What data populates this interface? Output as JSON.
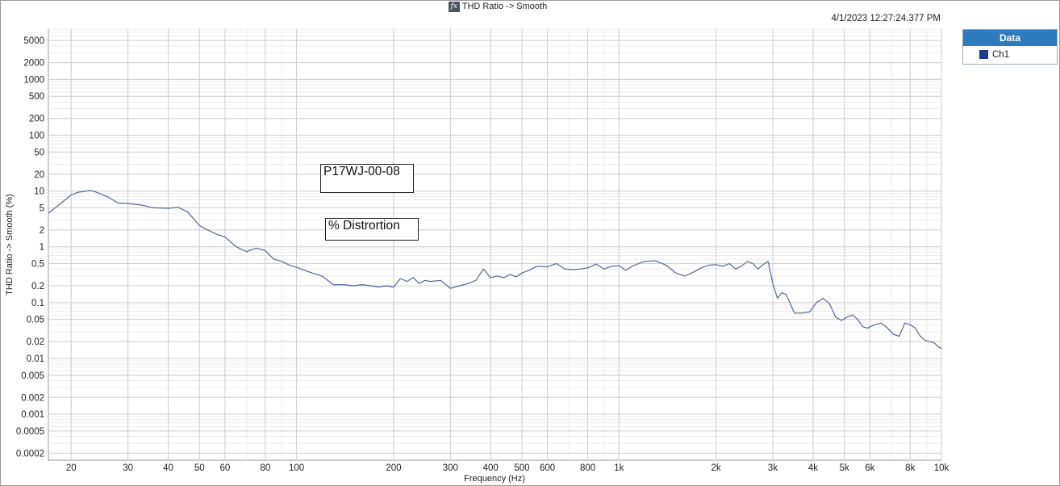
{
  "header": {
    "title": "THD Ratio -> Smooth",
    "fx_icon": "fx-icon",
    "timestamp": "4/1/2023 12:27:24.377 PM",
    "logo": "ap-logo"
  },
  "legend": {
    "header": "Data",
    "items": [
      {
        "label": "Ch1",
        "color": "#1b3a8c"
      }
    ]
  },
  "annotations": [
    "P17WJ-00-08",
    "% Distrortion"
  ],
  "chart_data": {
    "type": "line",
    "title": "THD Ratio -> Smooth",
    "xlabel": "Frequency (Hz)",
    "ylabel": "THD Ratio -> Smooth (%)",
    "xscale": "log",
    "yscale": "log",
    "xlim": [
      17,
      10000
    ],
    "ylim": [
      0.00015,
      8000
    ],
    "grid": true,
    "legend_position": "right",
    "x_ticks": [
      {
        "v": 20,
        "label": "20"
      },
      {
        "v": 30,
        "label": "30"
      },
      {
        "v": 40,
        "label": "40"
      },
      {
        "v": 50,
        "label": "50"
      },
      {
        "v": 60,
        "label": "60"
      },
      {
        "v": 80,
        "label": "80"
      },
      {
        "v": 100,
        "label": "100"
      },
      {
        "v": 200,
        "label": "200"
      },
      {
        "v": 300,
        "label": "300"
      },
      {
        "v": 400,
        "label": "400"
      },
      {
        "v": 500,
        "label": "500"
      },
      {
        "v": 600,
        "label": "600"
      },
      {
        "v": 800,
        "label": "800"
      },
      {
        "v": 1000,
        "label": "1k"
      },
      {
        "v": 2000,
        "label": "2k"
      },
      {
        "v": 3000,
        "label": "3k"
      },
      {
        "v": 4000,
        "label": "4k"
      },
      {
        "v": 5000,
        "label": "5k"
      },
      {
        "v": 6000,
        "label": "6k"
      },
      {
        "v": 8000,
        "label": "8k"
      },
      {
        "v": 10000,
        "label": "10k"
      }
    ],
    "y_ticks": [
      {
        "v": 5000,
        "label": "5000"
      },
      {
        "v": 2000,
        "label": "2000"
      },
      {
        "v": 1000,
        "label": "1000"
      },
      {
        "v": 500,
        "label": "500"
      },
      {
        "v": 200,
        "label": "200"
      },
      {
        "v": 100,
        "label": "100"
      },
      {
        "v": 50,
        "label": "50"
      },
      {
        "v": 20,
        "label": "20"
      },
      {
        "v": 10,
        "label": "10"
      },
      {
        "v": 5,
        "label": "5"
      },
      {
        "v": 2,
        "label": "2"
      },
      {
        "v": 1,
        "label": "1"
      },
      {
        "v": 0.5,
        "label": "0.5"
      },
      {
        "v": 0.2,
        "label": "0.2"
      },
      {
        "v": 0.1,
        "label": "0.1"
      },
      {
        "v": 0.05,
        "label": "0.05"
      },
      {
        "v": 0.02,
        "label": "0.02"
      },
      {
        "v": 0.01,
        "label": "0.01"
      },
      {
        "v": 0.005,
        "label": "0.005"
      },
      {
        "v": 0.002,
        "label": "0.002"
      },
      {
        "v": 0.001,
        "label": "0.001"
      },
      {
        "v": 0.0005,
        "label": "0.0005"
      },
      {
        "v": 0.0002,
        "label": "0.0002"
      }
    ],
    "series": [
      {
        "name": "Ch1",
        "color": "#4b68a8",
        "x": [
          17,
          18,
          20,
          21,
          23,
          24,
          26,
          28,
          30,
          33,
          36,
          40,
          43,
          46,
          50,
          53,
          57,
          60,
          65,
          70,
          75,
          80,
          85,
          90,
          95,
          100,
          110,
          120,
          130,
          140,
          150,
          160,
          170,
          180,
          190,
          200,
          210,
          220,
          230,
          240,
          250,
          260,
          280,
          300,
          320,
          340,
          360,
          380,
          400,
          420,
          440,
          460,
          480,
          500,
          520,
          560,
          600,
          640,
          680,
          720,
          760,
          800,
          850,
          900,
          950,
          1000,
          1050,
          1100,
          1150,
          1200,
          1300,
          1400,
          1500,
          1600,
          1700,
          1800,
          1900,
          2000,
          2100,
          2200,
          2300,
          2400,
          2500,
          2600,
          2700,
          2800,
          2900,
          3000,
          3100,
          3200,
          3300,
          3500,
          3700,
          3900,
          4100,
          4300,
          4500,
          4700,
          4900,
          5100,
          5300,
          5500,
          5700,
          5900,
          6200,
          6500,
          6800,
          7100,
          7400,
          7700,
          8000,
          8300,
          8600,
          8900,
          9200,
          9500,
          9800,
          10000
        ],
        "y": [
          4,
          5.2,
          8.5,
          9.5,
          10.2,
          9.5,
          7.8,
          6.1,
          6.0,
          5.6,
          5.0,
          4.9,
          5.1,
          4.2,
          2.4,
          2.0,
          1.65,
          1.5,
          1.0,
          0.82,
          0.95,
          0.85,
          0.6,
          0.55,
          0.47,
          0.43,
          0.35,
          0.3,
          0.21,
          0.21,
          0.2,
          0.21,
          0.2,
          0.19,
          0.2,
          0.19,
          0.27,
          0.24,
          0.28,
          0.22,
          0.25,
          0.24,
          0.25,
          0.18,
          0.2,
          0.22,
          0.25,
          0.4,
          0.28,
          0.3,
          0.28,
          0.32,
          0.29,
          0.34,
          0.37,
          0.45,
          0.44,
          0.5,
          0.4,
          0.39,
          0.4,
          0.42,
          0.49,
          0.4,
          0.45,
          0.46,
          0.38,
          0.45,
          0.5,
          0.55,
          0.56,
          0.47,
          0.34,
          0.3,
          0.35,
          0.42,
          0.47,
          0.48,
          0.45,
          0.5,
          0.4,
          0.45,
          0.55,
          0.5,
          0.4,
          0.48,
          0.55,
          0.22,
          0.12,
          0.15,
          0.14,
          0.065,
          0.065,
          0.068,
          0.1,
          0.12,
          0.095,
          0.055,
          0.048,
          0.055,
          0.06,
          0.05,
          0.037,
          0.035,
          0.04,
          0.043,
          0.035,
          0.027,
          0.025,
          0.043,
          0.04,
          0.035,
          0.025,
          0.021,
          0.02,
          0.019,
          0.016,
          0.015
        ]
      }
    ]
  }
}
